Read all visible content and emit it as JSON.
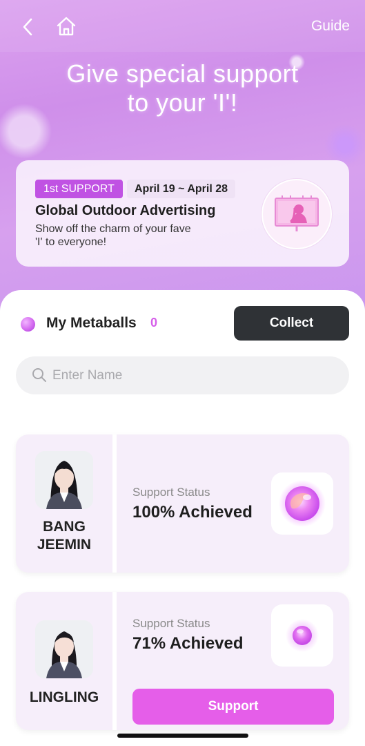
{
  "header": {
    "guide_label": "Guide",
    "headline_line1": "Give special support",
    "headline_line2": "to your 'I'!"
  },
  "event": {
    "badge": "1st SUPPORT",
    "dates": "April 19 ~ April 28",
    "title": "Global Outdoor Advertising",
    "description": "Show off the charm of your fave 'I' to everyone!"
  },
  "metaballs": {
    "label": "My Metaballs",
    "count": "0",
    "collect_label": "Collect"
  },
  "search": {
    "placeholder": "Enter Name",
    "value": ""
  },
  "members": [
    {
      "name_line1": "BANG",
      "name_line2": "JEEMIN",
      "status_label": "Support Status",
      "status_value": "100% Achieved",
      "achieved_percent": 100
    },
    {
      "name_line1": "LINGLING",
      "status_label": "Support Status",
      "status_value": "71% Achieved",
      "achieved_percent": 71,
      "button_label": "Support"
    }
  ],
  "colors": {
    "accent": "#e55ee9",
    "badge": "#c052e3",
    "dark_button": "#2f3236"
  },
  "icons": [
    "back-icon",
    "home-icon",
    "search-icon",
    "billboard-icon",
    "metaball-icon",
    "orb-icon"
  ]
}
